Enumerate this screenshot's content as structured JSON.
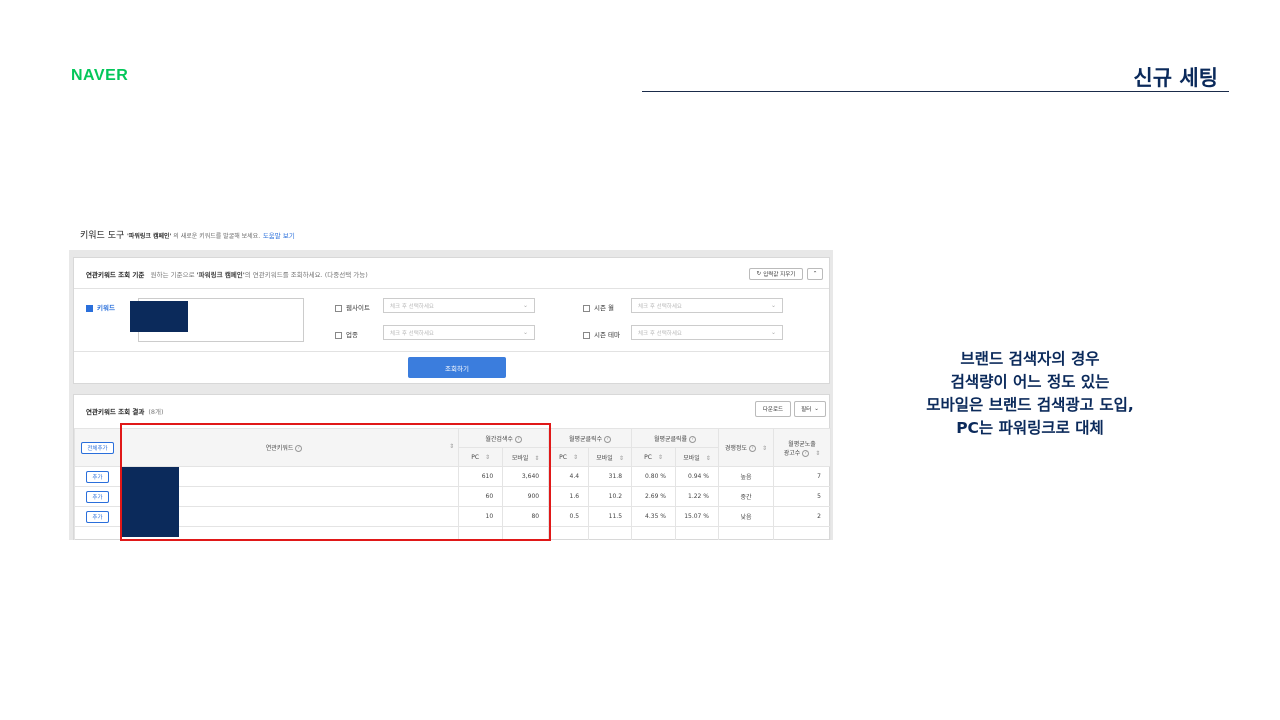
{
  "slide": {
    "logo": "NAVER",
    "title": "신규 세팅",
    "callout": [
      "브랜드 검색자의 경우",
      "검색량이 어느 정도 있는",
      "모바일은 브랜드 검색광고 도입,",
      "PC는 파워링크로 대체"
    ]
  },
  "tool": {
    "name": "키워드 도구",
    "campaign": "'파워링크 캠페인'",
    "subtitle": "의 새로운 키워드를 발굴해 보세요.",
    "help": "도움말 보기",
    "criteria": {
      "title": "연관키워드 조회 기준",
      "desc_prefix": "원하는 기준으로",
      "desc_campaign": "'파워링크 캠페인'",
      "desc_suffix": "의 연관키워드를 조회하세요. (다중선택 가능)",
      "reset_label": "입력값 지우기",
      "collapse_label": "⌃",
      "keyword_label": "키워드",
      "website_label": "웹사이트",
      "industry_label": "업종",
      "season_month_label": "시즌 월",
      "season_theme_label": "시즌 테마",
      "select_placeholder": "체크 후 선택하세요",
      "search_button": "조회하기"
    },
    "results": {
      "title": "연관키워드 조회 결과",
      "count": "(8개)",
      "download": "다운로드",
      "filter": "필터",
      "add_all": "전체추가",
      "headers": {
        "keyword": "연관키워드",
        "monthly_search": "월간검색수",
        "avg_clicks": "월평균클릭수",
        "avg_ctr": "월평균클릭률",
        "competition": "경쟁정도",
        "avg_ads_line1": "월평균노출",
        "avg_ads_line2": "광고수",
        "pc": "PC",
        "mobile": "모바일"
      },
      "add_label": "추가",
      "rows": [
        {
          "search_pc": "610",
          "search_mobile": "3,640",
          "click_pc": "4.4",
          "click_mobile": "31.8",
          "ctr_pc": "0.80 %",
          "ctr_mobile": "0.94 %",
          "competition": "높음",
          "ads": "7"
        },
        {
          "search_pc": "60",
          "search_mobile": "900",
          "click_pc": "1.6",
          "click_mobile": "10.2",
          "ctr_pc": "2.69 %",
          "ctr_mobile": "1.22 %",
          "competition": "중간",
          "ads": "5"
        },
        {
          "search_pc": "10",
          "search_mobile": "80",
          "click_pc": "0.5",
          "click_mobile": "11.5",
          "ctr_pc": "4.35 %",
          "ctr_mobile": "15.07 %",
          "competition": "낮음",
          "ads": "2"
        }
      ]
    }
  },
  "colors": {
    "brand_green": "#03c75a",
    "navy": "#0b2a5b",
    "highlight_red": "#e01818",
    "button_blue": "#3b7ddd"
  }
}
